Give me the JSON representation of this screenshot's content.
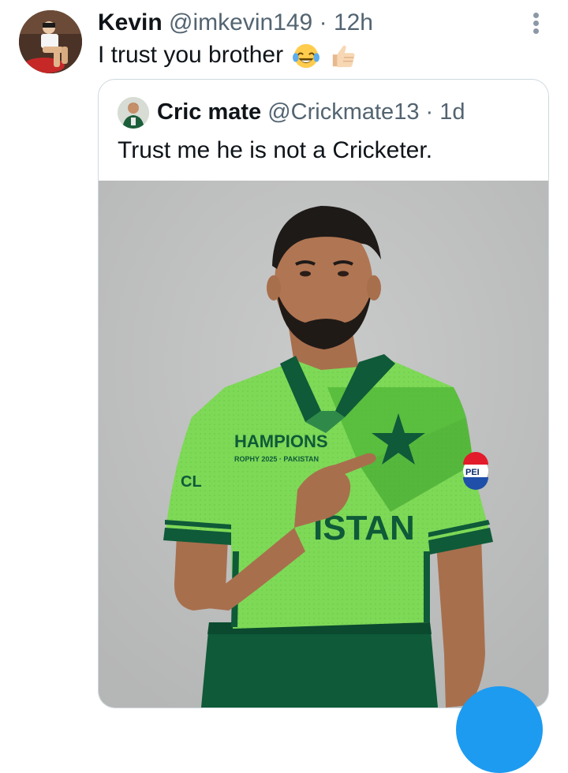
{
  "tweet": {
    "author_name": "Kevin",
    "handle": "@imkevin149",
    "separator": "·",
    "time": "12h",
    "text": "I trust you brother",
    "emojis": [
      "laughing-tears-emoji",
      "thumbs-up-emoji"
    ]
  },
  "quote": {
    "author_name": "Cric mate",
    "handle": "@Crickmate13",
    "separator": "·",
    "time": "1d",
    "text": "Trust me he is not a Cricketer."
  },
  "jersey": {
    "champions_text": "HAMPIONS",
    "trophy_text": "ROPHY 2025 · PAKISTAN",
    "team_text": "ISTAN",
    "sponsor_text": "PEI",
    "sleeve_text": "CL"
  },
  "colors": {
    "jersey_green": "#7ed957",
    "jersey_dark": "#0f5a38",
    "accent_blue": "#1d9bf0"
  },
  "icons": {
    "more": "more-vertical-icon"
  }
}
